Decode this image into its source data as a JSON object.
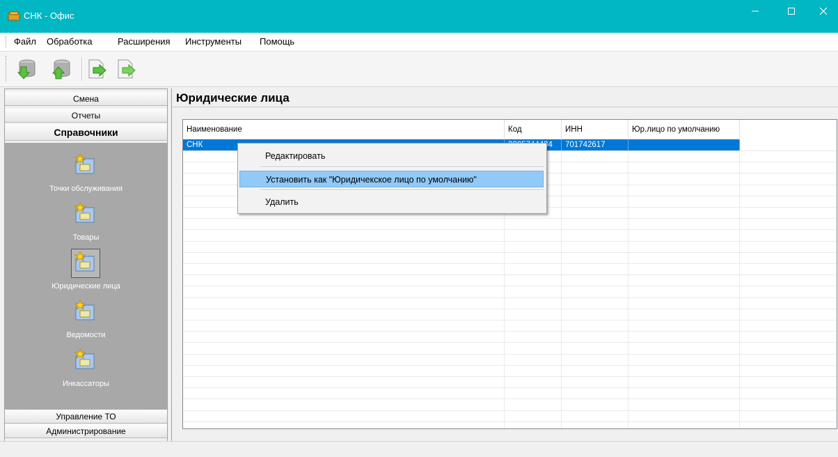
{
  "window": {
    "title": "СНК - Офис",
    "accent": "#00b7c3",
    "controls": [
      "minimize-icon",
      "maximize-icon",
      "close-icon"
    ]
  },
  "menu": {
    "items": [
      "Файл",
      "Обработка",
      "Расширения",
      "Инструменты",
      "Помощь"
    ]
  },
  "toolbar": {
    "buttons": [
      "database-download-icon",
      "database-upload-icon",
      "export-arrow-icon",
      "export-arrow-disabled-icon"
    ]
  },
  "sidebar": {
    "sections": {
      "shift": "Смена",
      "reports": "Отчеты",
      "directories": "Справочники",
      "management": "Управление ТО",
      "admin": "Администрирование"
    },
    "items": [
      {
        "label": "Точки обслуживания",
        "icon": "folder-star-icon"
      },
      {
        "label": "Товары",
        "icon": "folder-star-icon"
      },
      {
        "label": "Юридические лица",
        "icon": "folder-star-icon"
      },
      {
        "label": "Ведомости",
        "icon": "folder-star-icon"
      },
      {
        "label": "Инкассаторы",
        "icon": "folder-star-icon"
      }
    ],
    "selected": "Юридические лица"
  },
  "main": {
    "title": "Юридические лица",
    "columns": [
      "Наименование",
      "Код",
      "ИНН",
      "Юр.лицо по умолчанию"
    ],
    "rows": [
      {
        "name": "СНК",
        "code": "3305744434",
        "inn": "701742617",
        "default": ""
      }
    ]
  },
  "context_menu": {
    "items": [
      "Редактировать",
      "Установить как \"Юридичекское лицо по умолчанию\"",
      "Удалить"
    ],
    "highlighted": "Установить как \"Юридичекское лицо по умолчанию\""
  },
  "colors": {
    "selection": "#0078d7",
    "menu_highlight": "#91c9f7",
    "sidebar_panel": "#a8a8a8"
  }
}
